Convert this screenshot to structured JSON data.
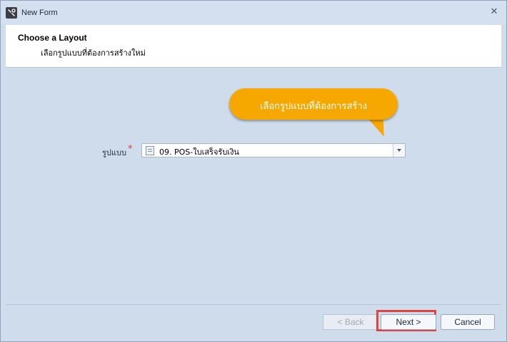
{
  "window": {
    "title": "New Form",
    "close_glyph": "✕",
    "icon": "wrench-app-icon"
  },
  "header": {
    "title": "Choose a Layout",
    "subtitle": "เลือกรูปแบบที่ต้องการสร้างใหม่"
  },
  "tooltip": {
    "text": "เลือกรูปแบบที่ต้องการสร้าง",
    "color": "#f6a800"
  },
  "form": {
    "layout_label": "รูปแบบ",
    "required_mark": "*",
    "layout_value": "09. POS-ใบเสร็จรับเงิน"
  },
  "footer": {
    "back_label": "< Back",
    "next_label": "Next >",
    "cancel_label": "Cancel",
    "highlight_color": "#e0443d"
  }
}
